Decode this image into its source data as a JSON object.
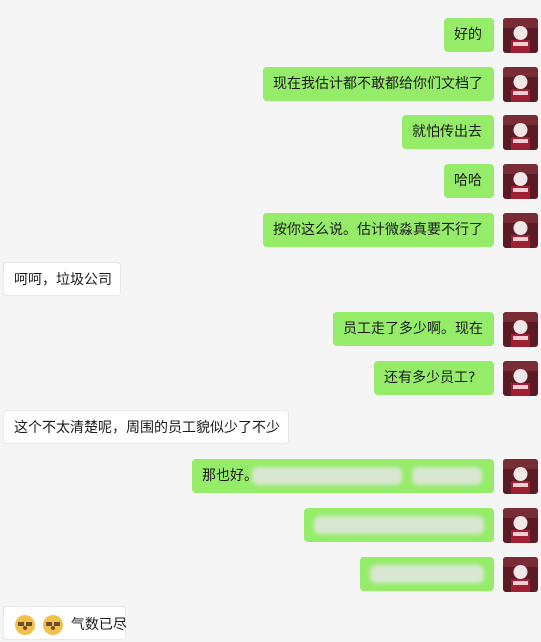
{
  "messages": [
    {
      "text": "好的"
    },
    {
      "text": "现在我估计都不敢都给你们文档了"
    },
    {
      "text": "就怕传出去"
    },
    {
      "text": "哈哈"
    },
    {
      "text": "按你这么说。估计微淼真要不行了"
    },
    {
      "text": "呵呵，垃圾公司"
    },
    {
      "text": "员工走了多少啊。现在"
    },
    {
      "text": "还有多少员工?"
    },
    {
      "text": "这个不太清楚呢，周围的员工貌似少了不少"
    },
    {
      "text": "那也好。"
    },
    {
      "text": ""
    },
    {
      "text": ""
    },
    {
      "text": "气数已尽"
    }
  ],
  "theme": {
    "my_bubble_color": "#95ec69",
    "other_bubble_color": "#ffffff",
    "background": "#f5f5f5"
  },
  "icons": {
    "sender_avatar": "avatar-photo",
    "reaction_emoji": "doge-face-icon"
  }
}
